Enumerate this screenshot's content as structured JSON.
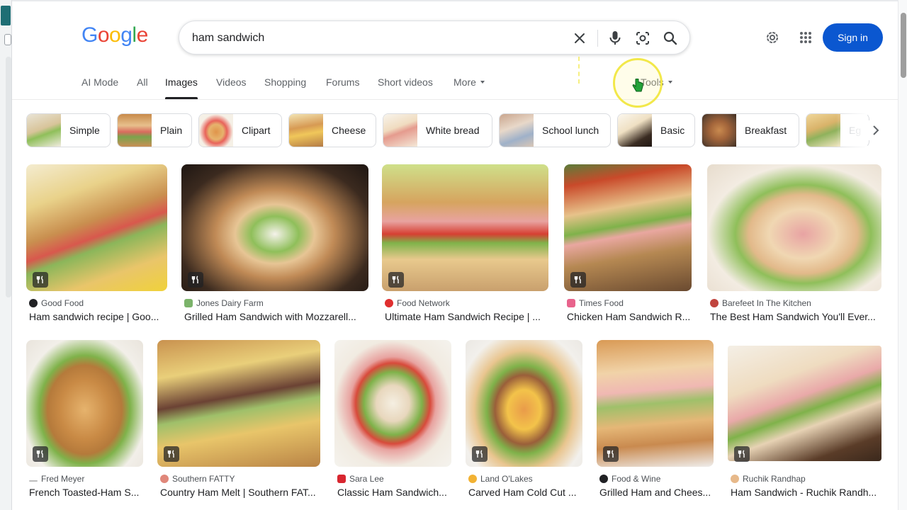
{
  "search": {
    "query": "ham sandwich",
    "logo_text": "Google"
  },
  "header": {
    "sign_in_label": "Sign in"
  },
  "tabs": [
    {
      "label": "AI Mode"
    },
    {
      "label": "All"
    },
    {
      "label": "Images",
      "active": true
    },
    {
      "label": "Videos"
    },
    {
      "label": "Shopping"
    },
    {
      "label": "Forums"
    },
    {
      "label": "Short videos"
    },
    {
      "label": "More"
    },
    {
      "label": "Tools"
    }
  ],
  "chips": [
    {
      "label": "Simple"
    },
    {
      "label": "Plain"
    },
    {
      "label": "Clipart"
    },
    {
      "label": "Cheese"
    },
    {
      "label": "White bread"
    },
    {
      "label": "School lunch"
    },
    {
      "label": "Basic"
    },
    {
      "label": "Breakfast"
    },
    {
      "label": "Eg"
    }
  ],
  "results_row1": [
    {
      "source": "Good Food",
      "title": "Ham sandwich recipe | Goo..."
    },
    {
      "source": "Jones Dairy Farm",
      "title": "Grilled Ham Sandwich with Mozzarell..."
    },
    {
      "source": "Food Network",
      "title": "Ultimate Ham Sandwich Recipe | ..."
    },
    {
      "source": "Times Food",
      "title": "Chicken Ham Sandwich R..."
    },
    {
      "source": "Barefeet In The Kitchen",
      "title": "The Best Ham Sandwich You'll Ever..."
    }
  ],
  "results_row2": [
    {
      "source": "Fred Meyer",
      "title": "French Toasted-Ham S..."
    },
    {
      "source": "Southern FATTY",
      "title": "Country Ham Melt | Southern FAT..."
    },
    {
      "source": "Sara Lee",
      "title": "Classic Ham Sandwich..."
    },
    {
      "source": "Land O'Lakes",
      "title": "Carved Ham Cold Cut ..."
    },
    {
      "source": "Food & Wine",
      "title": "Grilled Ham and Chees..."
    },
    {
      "source": "Ruchik Randhap",
      "title": "Ham Sandwich - Ruchik Randh..."
    }
  ],
  "icons": {
    "clear": "close-icon",
    "voice": "microphone-icon",
    "lens": "camera-lens-icon",
    "search": "search-icon",
    "settings": "gear-icon",
    "apps": "apps-grid-icon",
    "recipe_badge": "fork-knife-icon"
  },
  "colors": {
    "sign_in": "#0b57d0",
    "logo_blue": "#4285F4",
    "logo_red": "#EA4335",
    "logo_yellow": "#FBBC05",
    "logo_green": "#34A853"
  }
}
